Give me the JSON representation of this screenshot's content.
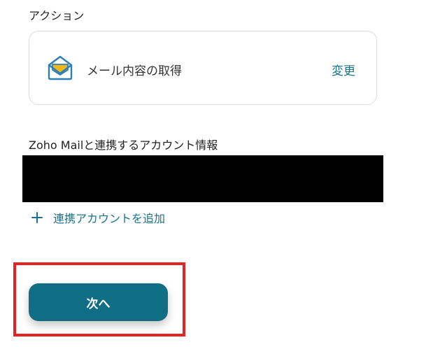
{
  "action_section": {
    "label": "アクション",
    "card": {
      "icon": "zoho-mail-icon",
      "title": "メール内容の取得",
      "change_label": "変更"
    }
  },
  "account_section": {
    "label": "Zoho Mailと連携するアカウント情報",
    "add_account_label": "連携アカウントを追加"
  },
  "footer": {
    "next_label": "次へ"
  },
  "colors": {
    "accent": "#18728a",
    "button": "#0f6e83",
    "highlight": "#e52422",
    "icon_yellow": "#f2b81b"
  }
}
